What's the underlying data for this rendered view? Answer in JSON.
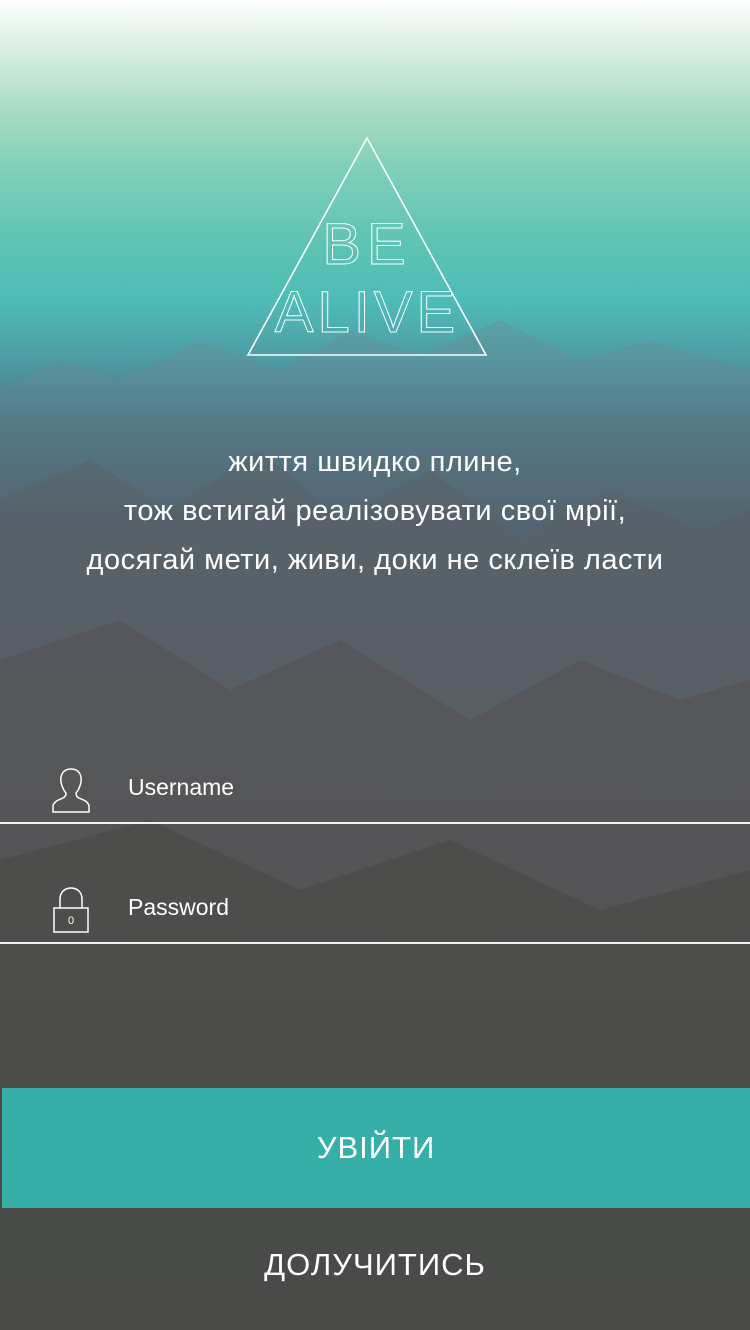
{
  "logo": {
    "line1": "BE",
    "line2": "ALIVE"
  },
  "tagline": [
    "життя швидко плине,",
    "тож встигай реалізовувати свої мрії,",
    "досягай мети, живи, доки не склеїв ласти"
  ],
  "form": {
    "username": {
      "placeholder": "Username",
      "icon": "user-icon"
    },
    "password": {
      "placeholder": "Password",
      "icon": "lock-icon"
    }
  },
  "buttons": {
    "login": "УВІЙТИ",
    "join": "ДОЛУЧИТИСЬ"
  },
  "colors": {
    "accent": "#36afa8",
    "text": "#ffffff"
  }
}
